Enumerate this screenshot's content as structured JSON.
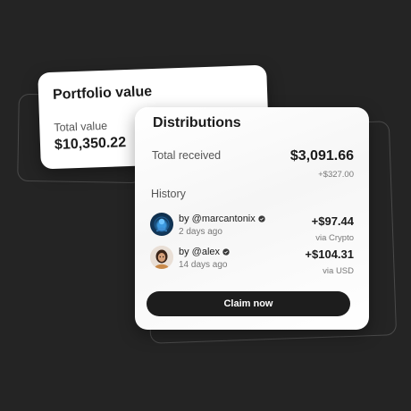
{
  "portfolio": {
    "title": "Portfolio value",
    "total_label": "Total value",
    "total_value": "$10,350.22"
  },
  "distributions": {
    "title": "Distributions",
    "total_received_label": "Total received",
    "total_received_value": "$3,091.66",
    "total_received_change": "+$327.00",
    "history_label": "History",
    "history": [
      {
        "by": "by @marcantonix",
        "time": "2 days ago",
        "amount": "+$97.44",
        "via": "via Crypto",
        "avatar_icon": "avatar-blue-figure"
      },
      {
        "by": "by @alex",
        "time": "14 days ago",
        "amount": "+$104.31",
        "via": "via USD",
        "avatar_icon": "avatar-person"
      }
    ],
    "claim_label": "Claim now"
  },
  "colors": {
    "background": "#242424",
    "card": "#ffffff",
    "primary_button": "#1d1d1d",
    "text_primary": "#1b1b1b",
    "text_secondary": "#777777"
  }
}
